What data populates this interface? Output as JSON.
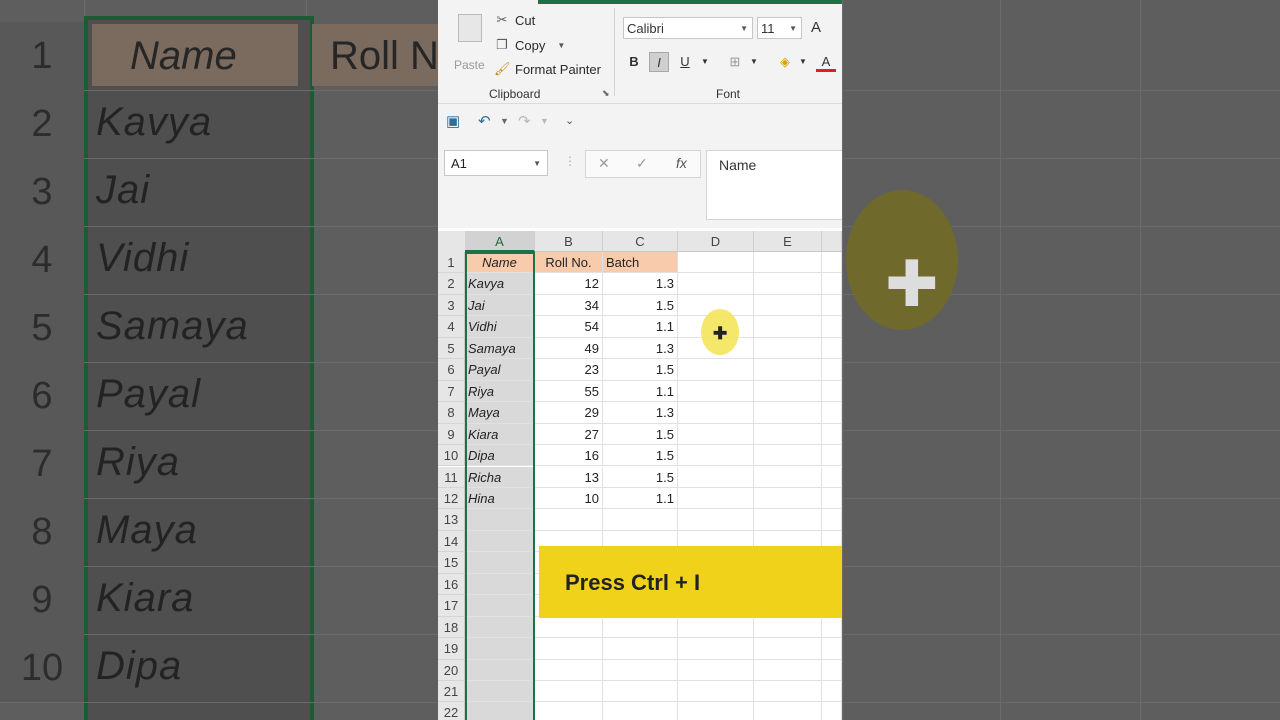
{
  "background": {
    "row_numbers": [
      "1",
      "2",
      "3",
      "4",
      "5",
      "6",
      "7",
      "8",
      "9",
      "10"
    ],
    "header_name": "Name",
    "header_roll": "Roll N",
    "names": [
      "Kavya",
      "Jai",
      "Vidhi",
      "Samaya",
      "Payal",
      "Riya",
      "Maya",
      "Kiara",
      "Dipa"
    ]
  },
  "ribbon": {
    "paste_label": "Paste",
    "cut_label": "Cut",
    "copy_label": "Copy",
    "format_painter_label": "Format Painter",
    "clipboard_group": "Clipboard",
    "font_group": "Font",
    "font_name": "Calibri",
    "font_size": "11",
    "bold": "B",
    "italic": "I",
    "underline": "U",
    "grow_font": "A"
  },
  "formula_bar": {
    "name_box": "A1",
    "cancel": "✕",
    "enter": "✓",
    "fx": "fx",
    "value": "Name"
  },
  "grid": {
    "columns": [
      "A",
      "B",
      "C",
      "D",
      "E"
    ],
    "row_numbers": [
      "1",
      "2",
      "3",
      "4",
      "5",
      "6",
      "7",
      "8",
      "9",
      "10",
      "11",
      "12",
      "13",
      "14",
      "15",
      "16",
      "17",
      "18",
      "19",
      "20",
      "21",
      "22"
    ],
    "headers": [
      "Name",
      "Roll No.",
      "Batch"
    ],
    "rows": [
      [
        "Kavya",
        "12",
        "1.3"
      ],
      [
        "Jai",
        "34",
        "1.5"
      ],
      [
        "Vidhi",
        "54",
        "1.1"
      ],
      [
        "Samaya",
        "49",
        "1.3"
      ],
      [
        "Payal",
        "23",
        "1.5"
      ],
      [
        "Riya",
        "55",
        "1.1"
      ],
      [
        "Maya",
        "29",
        "1.3"
      ],
      [
        "Kiara",
        "27",
        "1.5"
      ],
      [
        "Dipa",
        "16",
        "1.5"
      ],
      [
        "Richa",
        "13",
        "1.5"
      ],
      [
        "Hina",
        "10",
        "1.1"
      ]
    ]
  },
  "banner": {
    "text": "Press Ctrl + I"
  },
  "colors": {
    "accent": "#1e7145",
    "header_fill": "#f8cbad",
    "banner": "#f1d21a",
    "cursor_highlight": "#f4e45a"
  }
}
